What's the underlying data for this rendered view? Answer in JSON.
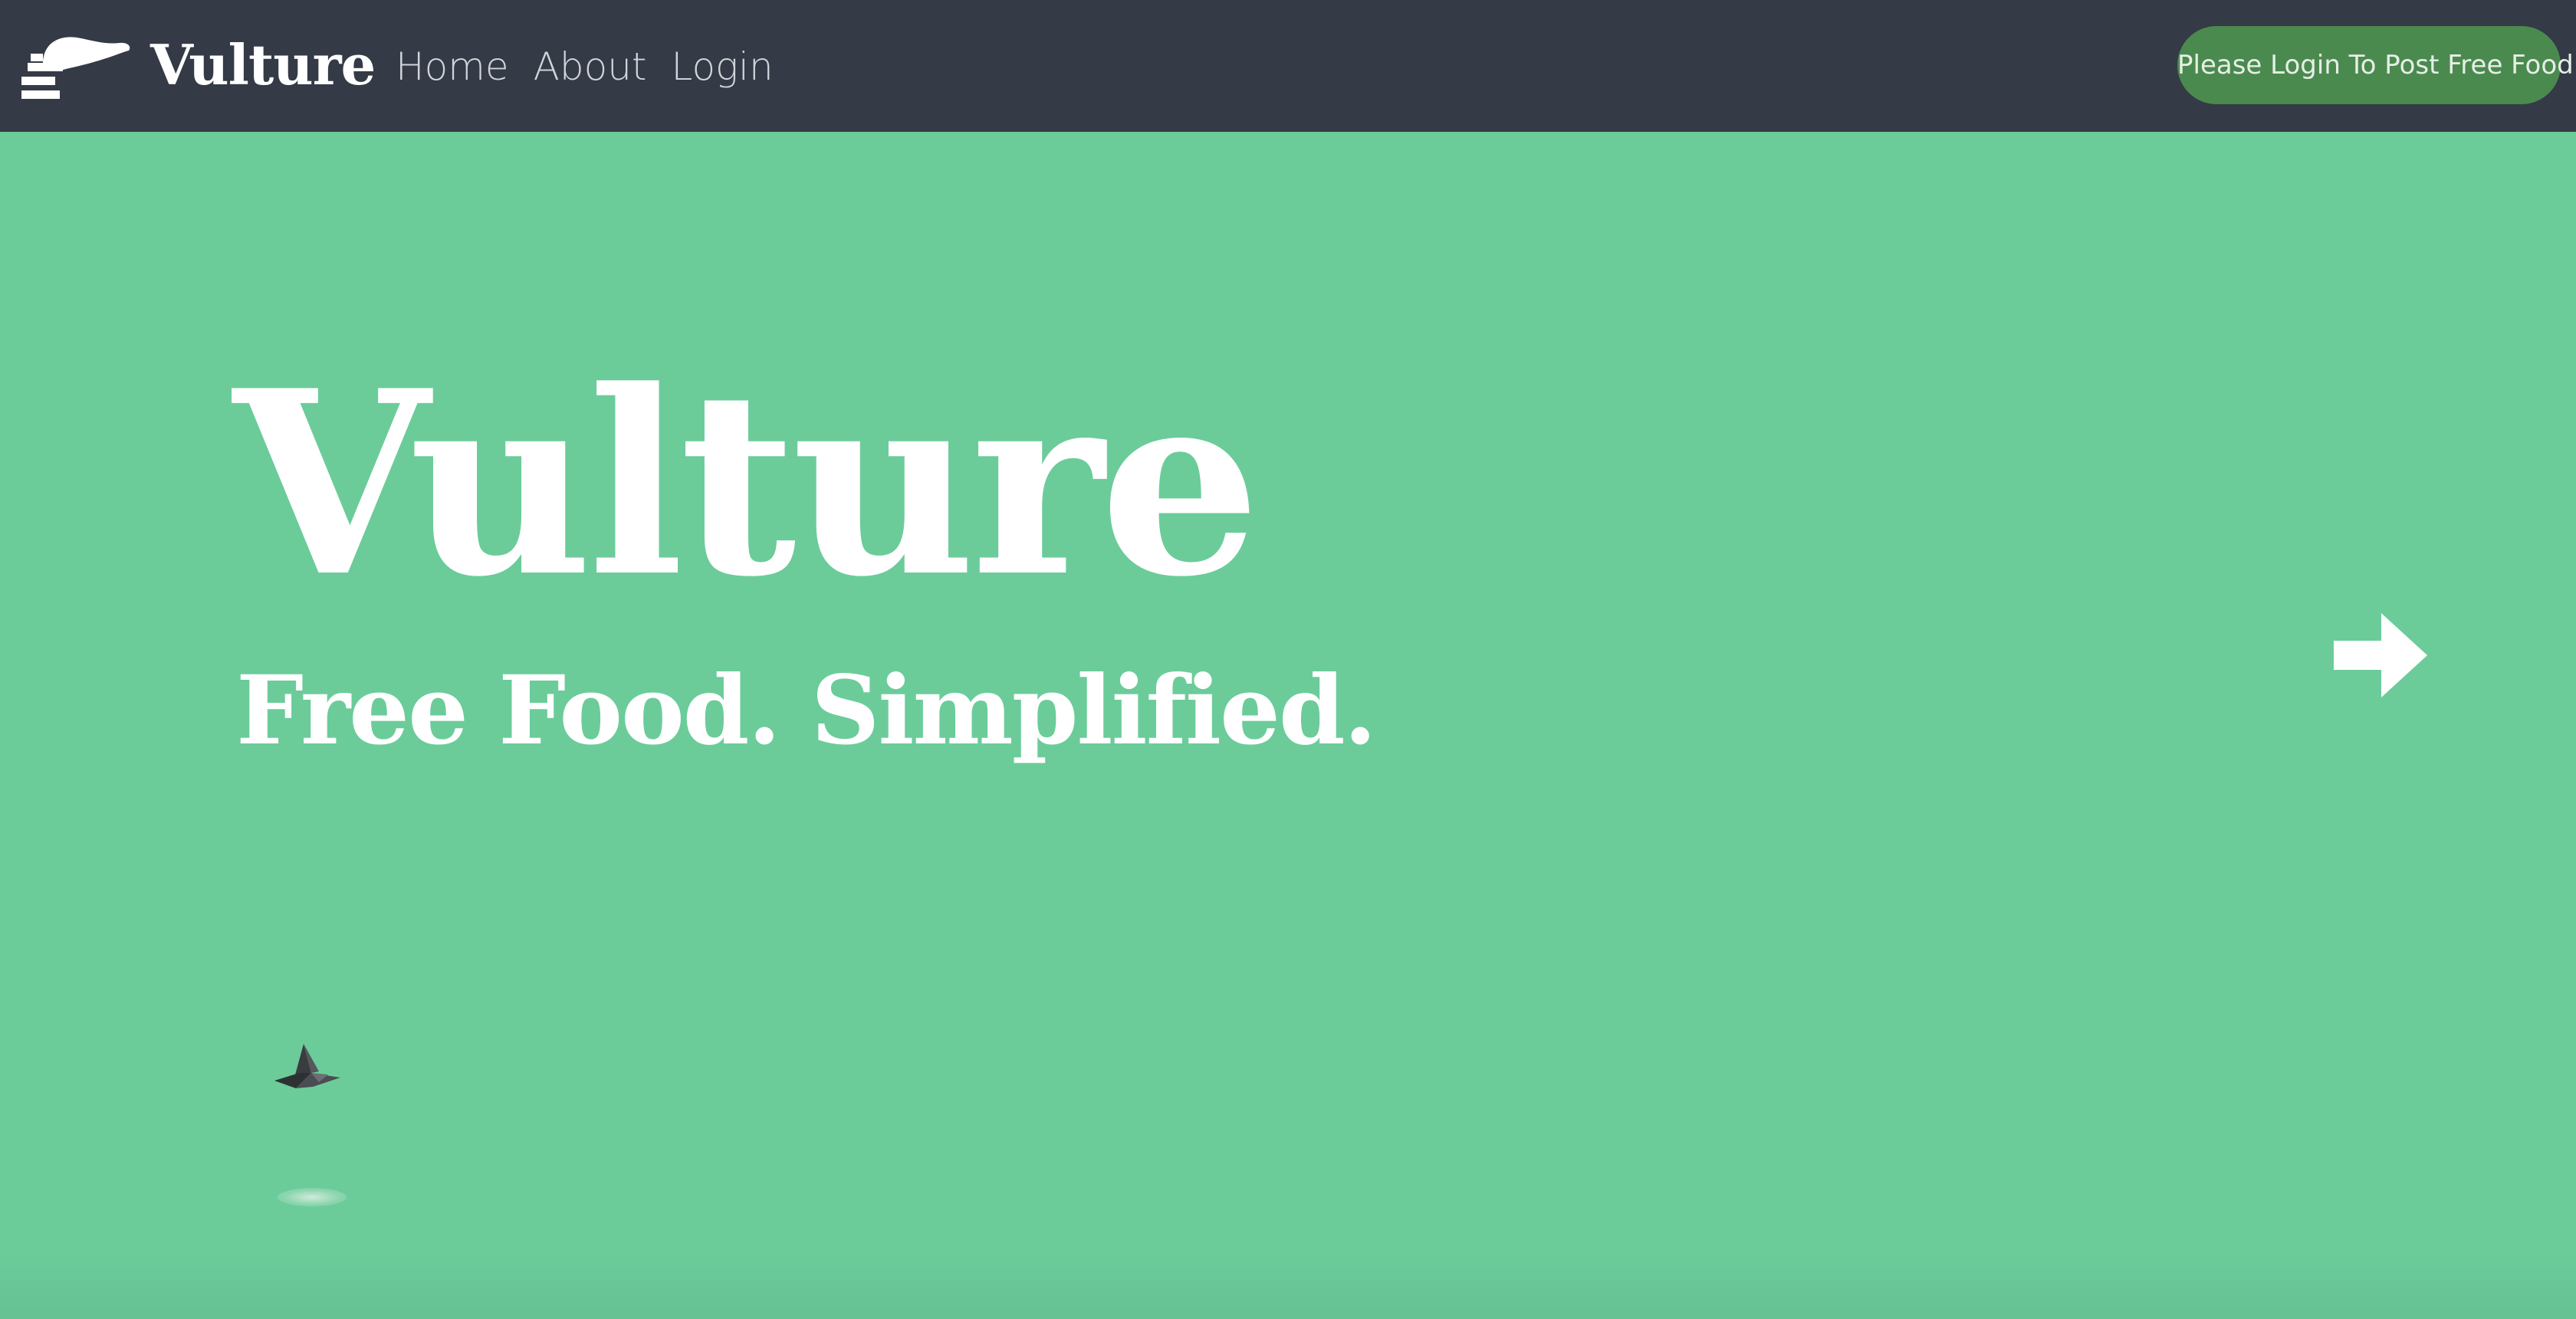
{
  "navbar": {
    "brand_name": "Vulture",
    "logo_icon": "vulture-logo-icon",
    "links": [
      {
        "label": "Home"
      },
      {
        "label": "About"
      },
      {
        "label": "Login"
      }
    ],
    "cta_label": "Please Login To Post Free Food"
  },
  "hero": {
    "title": "Vulture",
    "subtitle": "Free Food. Simplified.",
    "next_icon": "arrow-right-icon",
    "bird_icon": "vulture-bird-icon"
  },
  "colors": {
    "navbar_bg": "#343a46",
    "hero_bg": "#6bcc9a",
    "cta_bg": "#4b8a4f",
    "text_primary": "#ffffff"
  }
}
